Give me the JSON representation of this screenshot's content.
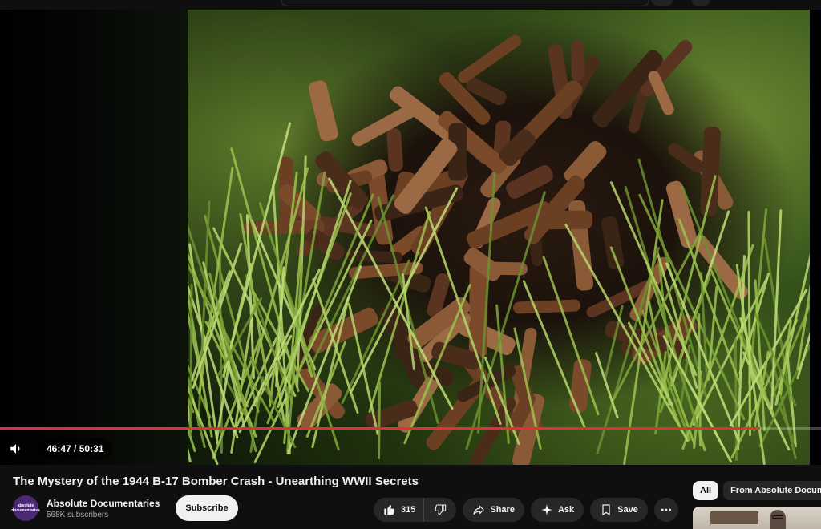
{
  "player": {
    "current_time": "46:47",
    "separator": " / ",
    "duration": "50:31",
    "progress_fraction": 0.926,
    "progress_color": "#e0303a",
    "volume_icon": "volume-icon"
  },
  "video": {
    "title": "The Mystery of the 1944 B-17 Bomber Crash - Unearthing WWII Secrets"
  },
  "channel": {
    "name": "Absolute Documentaries",
    "subscribers": "568K subscribers",
    "avatar_text": "absolute documentaries",
    "avatar_color": "#4b2a73",
    "subscribe_label": "Subscribe"
  },
  "actions": {
    "like_count": "315",
    "like_icon": "thumbs-up-icon",
    "dislike_icon": "thumbs-down-icon",
    "share_label": "Share",
    "ask_label": "Ask",
    "save_label": "Save",
    "more_icon": "more-horizontal-icon"
  },
  "chips": {
    "all": "All",
    "from_channel": "From Absolute Docume"
  }
}
